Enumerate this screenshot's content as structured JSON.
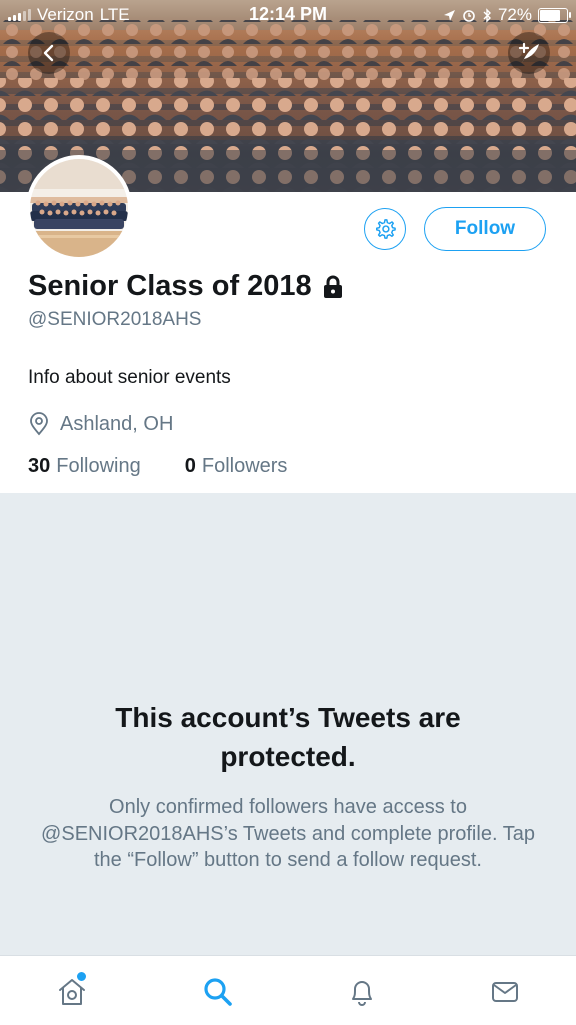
{
  "status_bar": {
    "carrier": "Verizon",
    "network": "LTE",
    "time": "12:14 PM",
    "battery": "72%"
  },
  "header": {
    "back_icon": "chevron-left-icon",
    "compose_icon": "compose-tweet-icon"
  },
  "profile": {
    "display_name": "Senior Class of 2018",
    "lock_icon": "lock-icon",
    "handle": "@SENIOR2018AHS",
    "bio": "Info about senior events",
    "location": "Ashland, OH",
    "following_count": "30",
    "following_label": "Following",
    "followers_count": "0",
    "followers_label": "Followers"
  },
  "actions": {
    "settings_icon": "gear-icon",
    "follow_label": "Follow"
  },
  "protected": {
    "title": "This account’s Tweets are protected.",
    "body": "Only confirmed followers have access to @SENIOR2018AHS’s Tweets and complete profile. Tap the “Follow” button to send a follow request."
  },
  "tabbar": {
    "tabs": [
      "home-icon",
      "search-icon",
      "notifications-icon",
      "messages-icon"
    ]
  },
  "colors": {
    "accent": "#1da1f2",
    "muted": "#657786",
    "panel": "#e6ecf0"
  }
}
